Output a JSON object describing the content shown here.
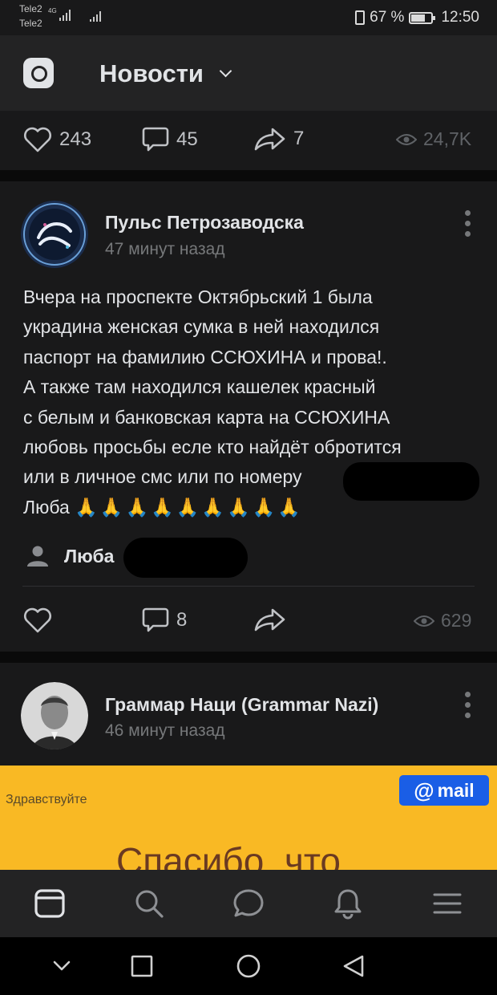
{
  "status_bar": {
    "carrier_1": "Tele2",
    "carrier_2": "Tele2",
    "network": "4G",
    "battery": "67 %",
    "time": "12:50"
  },
  "header": {
    "title": "Новости"
  },
  "prev_post": {
    "likes": "243",
    "comments": "45",
    "shares": "7",
    "views": "24,7K"
  },
  "post": {
    "author": "Пульс Петрозаводска",
    "time": "47 минут назад",
    "text_lines": [
      "Вчера на проспекте Октябрьский 1 была",
      "украдина женская сумка в ней находился",
      "паспорт на фамилию ССЮХИНА и прова!.",
      "А также там находился кашелек красный",
      "с белым и банковская карта на ССЮХИНА",
      "любовь просьбы есле кто найдёт обротится",
      "или в личное смс или по номеру",
      "Люба"
    ],
    "emoji": "🙏🙏🙏🙏🙏🙏🙏🙏🙏",
    "signer": "Люба",
    "comments": "8",
    "views": "629"
  },
  "next_post": {
    "author": "Граммар Наци (Grammar Nazi)",
    "time": "46 минут назад"
  },
  "ad": {
    "greeting": "Здравствуйте",
    "brand": "mail",
    "headline": "Спасибо, что"
  },
  "tabs": [
    "news-icon",
    "search-icon",
    "messages-icon",
    "notifications-icon",
    "menu-icon"
  ],
  "colors": {
    "ad_bg": "#f9b924",
    "mail_blue": "#1a5ee6",
    "card_bg": "#19191a"
  }
}
